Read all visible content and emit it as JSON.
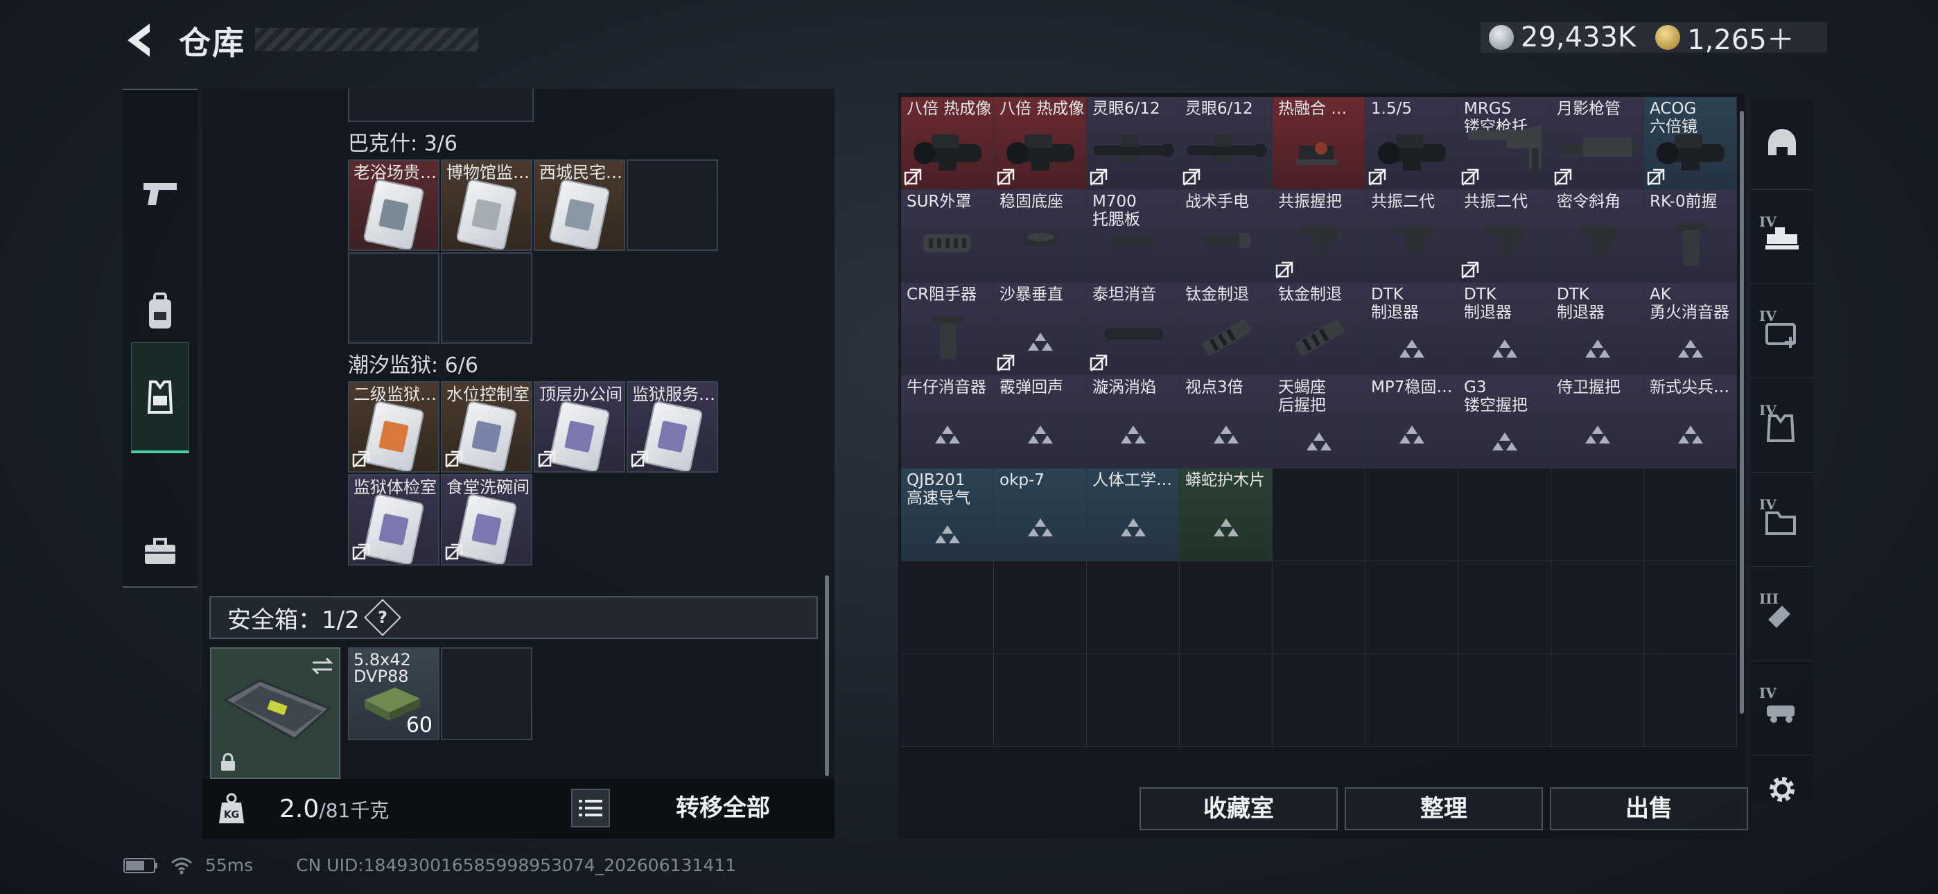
{
  "header": {
    "title": "仓库",
    "currency": [
      {
        "icon": "silver-coin-icon",
        "value": "29,433K"
      },
      {
        "icon": "gold-coin-icon",
        "value": "1,265＋"
      }
    ]
  },
  "left_nav": [
    {
      "icon": "pistol-icon"
    },
    {
      "icon": "backpack-icon"
    },
    {
      "icon": "vest-icon",
      "active": true
    },
    {
      "icon": "toolbox-icon"
    }
  ],
  "groups": [
    {
      "title": "巴克什: 3/6",
      "items": [
        {
          "name": "老浴场贵…",
          "tint": "red",
          "accent": "#7a8a96"
        },
        {
          "name": "博物馆监…",
          "tint": "brown",
          "accent": "#a6acb4"
        },
        {
          "name": "西城民宅…",
          "tint": "brown",
          "accent": "#8a98a6"
        }
      ]
    },
    {
      "title": "潮汐监狱: 6/6",
      "items": [
        {
          "name": "二级监狱…",
          "tint": "brown",
          "accent": "#d9783a"
        },
        {
          "name": "水位控制室",
          "tint": "brown",
          "accent": "#7a84a8"
        },
        {
          "name": "顶层办公间",
          "tint": "purple",
          "accent": "#7c78b0"
        },
        {
          "name": "监狱服务…",
          "tint": "purple",
          "accent": "#7c78b0"
        },
        {
          "name": "监狱体检室",
          "tint": "purple",
          "accent": "#7c78b0"
        },
        {
          "name": "食堂洗碗间",
          "tint": "purple",
          "accent": "#7c78b0"
        }
      ]
    }
  ],
  "safebox": {
    "label": "安全箱：1/2",
    "help": "?"
  },
  "safebox_item": {
    "name": "5.8x42 DVP88",
    "count": "60"
  },
  "weight": {
    "value": "2.0",
    "total": "/81千克",
    "icon": "kg-weight-icon"
  },
  "transfer_all": "转移全部",
  "grid_items": [
    {
      "name": "八倍 热成像",
      "tint": "red",
      "img": "scope"
    },
    {
      "name": "八倍 热成像",
      "tint": "red",
      "img": "scope"
    },
    {
      "name": "灵眼6/12",
      "tint": "purple",
      "img": "longscope"
    },
    {
      "name": "灵眼6/12",
      "tint": "purple",
      "img": "longscope"
    },
    {
      "name": "热融合 …",
      "tint": "red",
      "img": "reddot"
    },
    {
      "name": "1.5/5",
      "tint": "purple",
      "img": "scope"
    },
    {
      "name": "MRGS\n镂空枪托",
      "tint": "purple",
      "img": "stock"
    },
    {
      "name": "月影枪管",
      "tint": "purple",
      "img": "barrel"
    },
    {
      "name": "ACOG\n六倍镜",
      "tint": "blue",
      "img": "scope"
    },
    {
      "name": "SUR外罩",
      "tint": "purple",
      "img": "cover"
    },
    {
      "name": "稳固底座",
      "tint": "purple",
      "img": "mount"
    },
    {
      "name": "M700\n托腮板",
      "tint": "purple",
      "img": "small"
    },
    {
      "name": "战术手电",
      "tint": "purple",
      "img": "flashlight"
    },
    {
      "name": "共振握把",
      "tint": "purple",
      "img": "grip"
    },
    {
      "name": "共振二代",
      "tint": "purple",
      "img": "grip"
    },
    {
      "name": "共振二代",
      "tint": "purple",
      "img": "grip"
    },
    {
      "name": "密令斜角",
      "tint": "purple",
      "img": "grip"
    },
    {
      "name": "RK-0前握",
      "tint": "purple",
      "img": "vgrip"
    },
    {
      "name": "CR阻手器",
      "tint": "purple",
      "img": "vgrip"
    },
    {
      "name": "沙暴垂直",
      "tint": "purple",
      "img": "tri"
    },
    {
      "name": "泰坦消音",
      "tint": "purple",
      "img": "suppressor"
    },
    {
      "name": "钛金制退",
      "tint": "purple",
      "img": "brake"
    },
    {
      "name": "钛金制退",
      "tint": "purple",
      "img": "brake"
    },
    {
      "name": "DTK\n制退器",
      "tint": "purple",
      "img": "tri"
    },
    {
      "name": "DTK\n制退器",
      "tint": "purple",
      "img": "tri"
    },
    {
      "name": "DTK\n制退器",
      "tint": "purple",
      "img": "tri"
    },
    {
      "name": "AK\n勇火消音器",
      "tint": "purple",
      "img": "tri"
    },
    {
      "name": "牛仔消音器",
      "tint": "purple",
      "img": "tri"
    },
    {
      "name": "霰弹回声",
      "tint": "purple",
      "img": "tri"
    },
    {
      "name": "漩涡消焰",
      "tint": "purple",
      "img": "tri"
    },
    {
      "name": "视点3倍",
      "tint": "purple",
      "img": "tri"
    },
    {
      "name": "天蝎座\n后握把",
      "tint": "purple",
      "img": "tri"
    },
    {
      "name": "MP7稳固…",
      "tint": "purple",
      "img": "tri"
    },
    {
      "name": "G3\n镂空握把",
      "tint": "purple",
      "img": "tri"
    },
    {
      "name": "侍卫握把",
      "tint": "purple",
      "img": "tri"
    },
    {
      "name": "新式尖兵…",
      "tint": "purple",
      "img": "tri"
    },
    {
      "name": "QJB201\n高速导气",
      "tint": "blue",
      "img": "tri"
    },
    {
      "name": "okp-7",
      "tint": "blue",
      "img": "tri"
    },
    {
      "name": "人体工学…",
      "tint": "blue",
      "img": "tri"
    },
    {
      "name": "蟒蛇护木片",
      "tint": "green",
      "img": "tri"
    }
  ],
  "nobind_indices": [
    0,
    1,
    2,
    3,
    5,
    6,
    7,
    8,
    13,
    15,
    19,
    20
  ],
  "actions": {
    "collection": "收藏室",
    "sort": "整理",
    "sell": "出售"
  },
  "right_nav": [
    {
      "icon": "helmet-icon",
      "tier": ""
    },
    {
      "icon": "scope-attachment-icon",
      "tier": "IV"
    },
    {
      "icon": "medkit-icon",
      "tier": "IV"
    },
    {
      "icon": "armor-icon",
      "tier": "IV"
    },
    {
      "icon": "folder-icon",
      "tier": "IV"
    },
    {
      "icon": "tool-icon",
      "tier": "III"
    },
    {
      "icon": "vehicle-icon",
      "tier": "IV"
    }
  ],
  "status": {
    "ping": "55ms",
    "uid": "CN UID:1849300165859989530​74_202606131411"
  }
}
